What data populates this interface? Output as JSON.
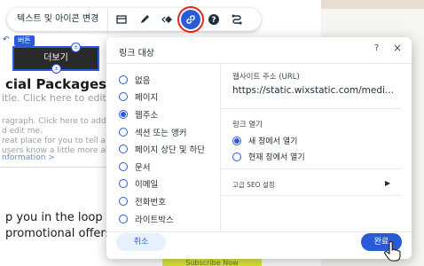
{
  "toolbar": {
    "text_icon_button": "텍스트 및 아이콘 변경",
    "icons": [
      "layout-icon",
      "pen-icon",
      "animation-icon",
      "link-icon",
      "help-icon",
      "connect-icon"
    ]
  },
  "selected_element": {
    "tag": "버튼",
    "label": "더보기"
  },
  "background": {
    "heading": "cial Packages",
    "subtitle": "itle. Click here to edit me.",
    "paragraph_lines": [
      "ragraph. Click here to add you",
      "d edit me.",
      "reat place for you to tell a story",
      "users know a little more about"
    ],
    "link": "nformation >",
    "bottom_lines": [
      "p you in the loop regar",
      "promotional offers."
    ],
    "subscribe": "Subscribe Now"
  },
  "dialog": {
    "title": "링크 대상",
    "help": "?",
    "close": "×",
    "link_types": [
      {
        "label": "없음",
        "selected": false
      },
      {
        "label": "페이지",
        "selected": false
      },
      {
        "label": "웹주소",
        "selected": true
      },
      {
        "label": "섹션 또는 앵커",
        "selected": false
      },
      {
        "label": "페이지 상단 및 하단",
        "selected": false
      },
      {
        "label": "문서",
        "selected": false
      },
      {
        "label": "이메일",
        "selected": false
      },
      {
        "label": "전화번호",
        "selected": false
      },
      {
        "label": "라이트박스",
        "selected": false
      }
    ],
    "url_label": "웹사이트 주소 (URL)",
    "url_value": "https://static.wixstatic.com/medi...",
    "open_label": "링크 열기",
    "open_options": [
      {
        "label": "새 창에서 열기",
        "selected": true
      },
      {
        "label": "현재 창에서 열기",
        "selected": false
      }
    ],
    "seo_label": "고급 SEO 설정",
    "cancel": "취소",
    "done": "완료"
  },
  "colors": {
    "accent": "#2b5ad8",
    "highlight": "#e0271f"
  }
}
